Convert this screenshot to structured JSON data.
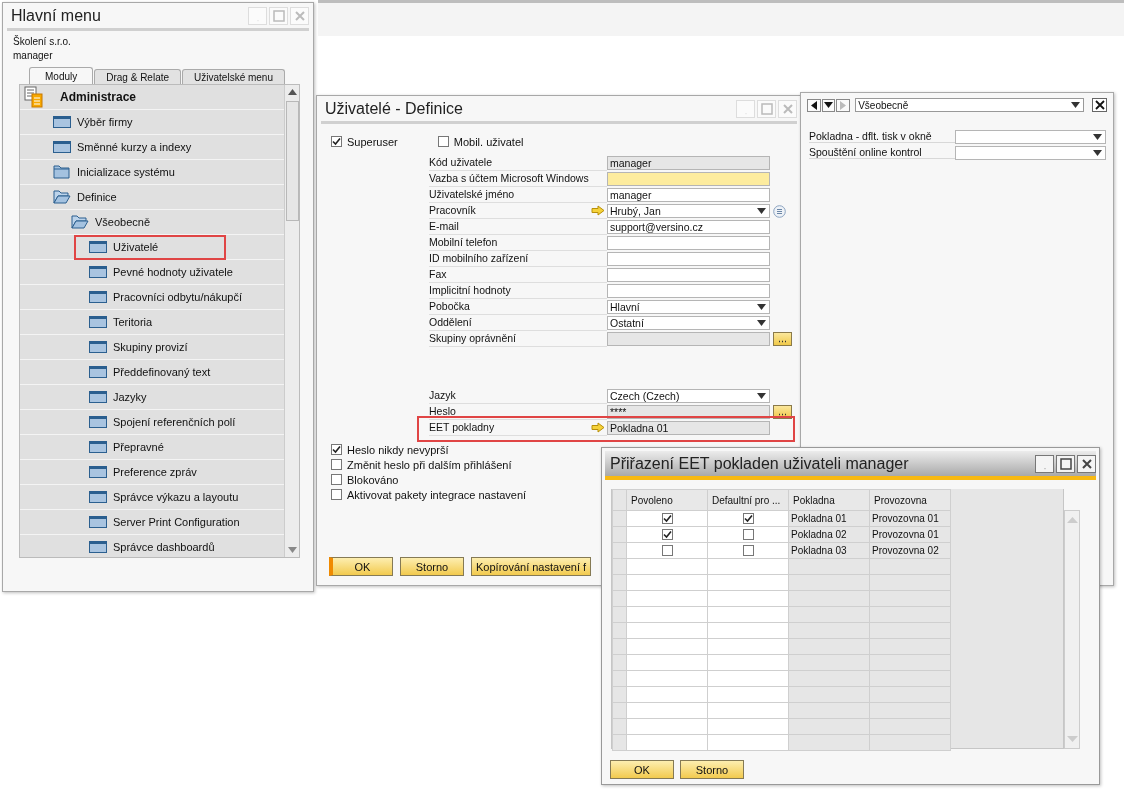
{
  "main_menu": {
    "title": "Hlavní menu",
    "company": "Školení s.r.o.",
    "user": "manager",
    "tabs": [
      {
        "label": "Moduly",
        "selected": true
      },
      {
        "label": "Drag & Relate",
        "selected": false
      },
      {
        "label": "Uživatelské menu",
        "selected": false
      }
    ],
    "tree": [
      {
        "label": "Administrace",
        "kind": "module",
        "highlighted": false,
        "children": [
          {
            "label": "Výběr firmy",
            "kind": "form",
            "highlighted": false
          },
          {
            "label": "Směnné kurzy a indexy",
            "kind": "form",
            "highlighted": false
          },
          {
            "label": "Inicializace systému",
            "kind": "folder",
            "expanded": false,
            "highlighted": false
          },
          {
            "label": "Definice",
            "kind": "folder",
            "expanded": true,
            "highlighted": false,
            "children": [
              {
                "label": "Všeobecně",
                "kind": "folder",
                "expanded": true,
                "highlighted": false,
                "children": [
                  {
                    "label": "Uživatelé",
                    "kind": "form",
                    "highlighted": true
                  },
                  {
                    "label": "Pevné hodnoty uživatele",
                    "kind": "form",
                    "highlighted": false
                  },
                  {
                    "label": "Pracovníci odbytu/nákupčí",
                    "kind": "form",
                    "highlighted": false
                  },
                  {
                    "label": "Teritoria",
                    "kind": "form",
                    "highlighted": false
                  },
                  {
                    "label": "Skupiny provizí",
                    "kind": "form",
                    "highlighted": false
                  },
                  {
                    "label": "Předdefinovaný text",
                    "kind": "form",
                    "highlighted": false
                  },
                  {
                    "label": "Jazyky",
                    "kind": "form",
                    "highlighted": false
                  },
                  {
                    "label": "Spojení referenčních polí",
                    "kind": "form",
                    "highlighted": false
                  },
                  {
                    "label": "Přepravné",
                    "kind": "form",
                    "highlighted": false
                  },
                  {
                    "label": "Preference zpráv",
                    "kind": "form",
                    "highlighted": false
                  },
                  {
                    "label": "Správce výkazu a layoutu",
                    "kind": "form",
                    "highlighted": false
                  },
                  {
                    "label": "Server Print Configuration",
                    "kind": "form",
                    "highlighted": false
                  },
                  {
                    "label": "Správce dashboardů",
                    "kind": "form",
                    "highlighted": false
                  }
                ]
              }
            ]
          }
        ]
      }
    ]
  },
  "user_definition": {
    "title": "Uživatelé - Definice",
    "top_checks": [
      {
        "label": "Superuser",
        "checked": true
      },
      {
        "label": "Mobil. uživatel",
        "checked": false
      }
    ],
    "field_groups": [
      [
        {
          "label": "Kód uživatele",
          "value": "manager",
          "kind": "readonly",
          "link": false,
          "lookup": false,
          "info": false,
          "highlighted": false
        },
        {
          "label": "Vazba s účtem Microsoft Windows",
          "kind": "required",
          "link": false,
          "lookup": false,
          "info": false,
          "highlighted": false
        },
        {
          "label": "Uživatelské jméno",
          "value": "manager",
          "kind": "text",
          "link": false,
          "lookup": false,
          "info": false,
          "highlighted": false
        },
        {
          "label": "Pracovník",
          "value": "Hrubý, Jan",
          "kind": "select",
          "link": true,
          "lookup": false,
          "info": true,
          "highlighted": false
        },
        {
          "label": "E-mail",
          "value": "support@versino.cz",
          "kind": "text",
          "link": false,
          "lookup": false,
          "info": false,
          "highlighted": false
        },
        {
          "label": "Mobilní telefon",
          "kind": "text",
          "link": false,
          "lookup": false,
          "info": false,
          "highlighted": false
        },
        {
          "label": "ID mobilního zařízení",
          "kind": "text",
          "link": false,
          "lookup": false,
          "info": false,
          "highlighted": false
        },
        {
          "label": "Fax",
          "kind": "text",
          "link": false,
          "lookup": false,
          "info": false,
          "highlighted": false
        },
        {
          "label": "Implicitní hodnoty",
          "kind": "text",
          "link": false,
          "lookup": false,
          "info": false,
          "highlighted": false
        },
        {
          "label": "Pobočka",
          "value": "Hlavní",
          "kind": "select",
          "link": false,
          "lookup": false,
          "info": false,
          "highlighted": false
        },
        {
          "label": "Oddělení",
          "value": "Ostatní",
          "kind": "select",
          "link": false,
          "lookup": false,
          "info": false,
          "highlighted": false
        },
        {
          "label": "Skupiny oprávnění",
          "kind": "readonly",
          "link": false,
          "lookup": true,
          "info": false,
          "highlighted": false
        }
      ],
      [
        {
          "label": "Jazyk",
          "value": "Czech (Czech)",
          "kind": "select",
          "link": false,
          "lookup": false,
          "info": false,
          "highlighted": false
        },
        {
          "label": "Heslo",
          "value": "****",
          "kind": "readonly",
          "link": false,
          "lookup": true,
          "info": false,
          "highlighted": false
        },
        {
          "label": "EET pokladny",
          "value": "Pokladna 01",
          "kind": "readonly",
          "link": true,
          "lookup": false,
          "info": false,
          "highlighted": true
        }
      ]
    ],
    "options": [
      {
        "label": "Heslo nikdy nevyprší",
        "checked": true
      },
      {
        "label": "Změnit heslo při dalším přihlášení",
        "checked": false
      },
      {
        "label": "Blokováno",
        "checked": false
      },
      {
        "label": "Aktivovat pakety integrace nastavení",
        "checked": false
      }
    ],
    "buttons": [
      {
        "label": "OK",
        "default": true
      },
      {
        "label": "Storno",
        "default": false
      },
      {
        "label": "Kopírování nastavení f",
        "default": false
      }
    ]
  },
  "side_panel": {
    "section": "Všeobecně",
    "fields": [
      {
        "label": "Pokladna - dflt. tisk v okně"
      },
      {
        "label": "Spouštění online kontrol"
      }
    ]
  },
  "dialog": {
    "title": "Přiřazení EET pokladen uživateli manager",
    "columns": [
      "Povoleno",
      "Defaultní pro ...",
      "Pokladna",
      "Provozovna"
    ],
    "rows": [
      {
        "enabled": true,
        "default": true,
        "register": "Pokladna 01",
        "premises": "Provozovna 01"
      },
      {
        "enabled": true,
        "default": false,
        "register": "Pokladna 02",
        "premises": "Provozovna 01"
      },
      {
        "enabled": false,
        "default": false,
        "register": "Pokladna 03",
        "premises": "Provozovna 02"
      }
    ],
    "buttons": [
      {
        "label": "OK",
        "default": false
      },
      {
        "label": "Storno",
        "default": false
      }
    ]
  }
}
